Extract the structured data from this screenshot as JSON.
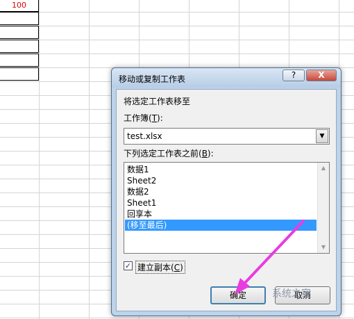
{
  "spreadsheet": {
    "top_cell_value": "100"
  },
  "dialog": {
    "title": "移动或复制工作表",
    "help_button": "?",
    "close_button": "X",
    "move_to_label": "将选定工作表移至",
    "workbook_label_prefix": "工作簿(",
    "workbook_label_key": "T",
    "workbook_label_suffix": "):",
    "workbook_value": "test.xlsx",
    "before_sheet_label_prefix": "下列选定工作表之前(",
    "before_sheet_label_key": "B",
    "before_sheet_label_suffix": "):",
    "sheets": [
      "数据1",
      "Sheet2",
      "数据2",
      "Sheet1",
      "回享本",
      "(移至最后)"
    ],
    "selected_sheet": "(移至最后)",
    "create_copy_prefix": "建立副本(",
    "create_copy_key": "C",
    "create_copy_suffix": ")",
    "create_copy_checked": true,
    "ok_button": "确定",
    "cancel_button": "取消"
  },
  "watermark": {
    "text": "系统之家"
  },
  "colors": {
    "arrow": "#e83ce0",
    "selection": "#3399ff",
    "cell_text": "#e00000"
  }
}
